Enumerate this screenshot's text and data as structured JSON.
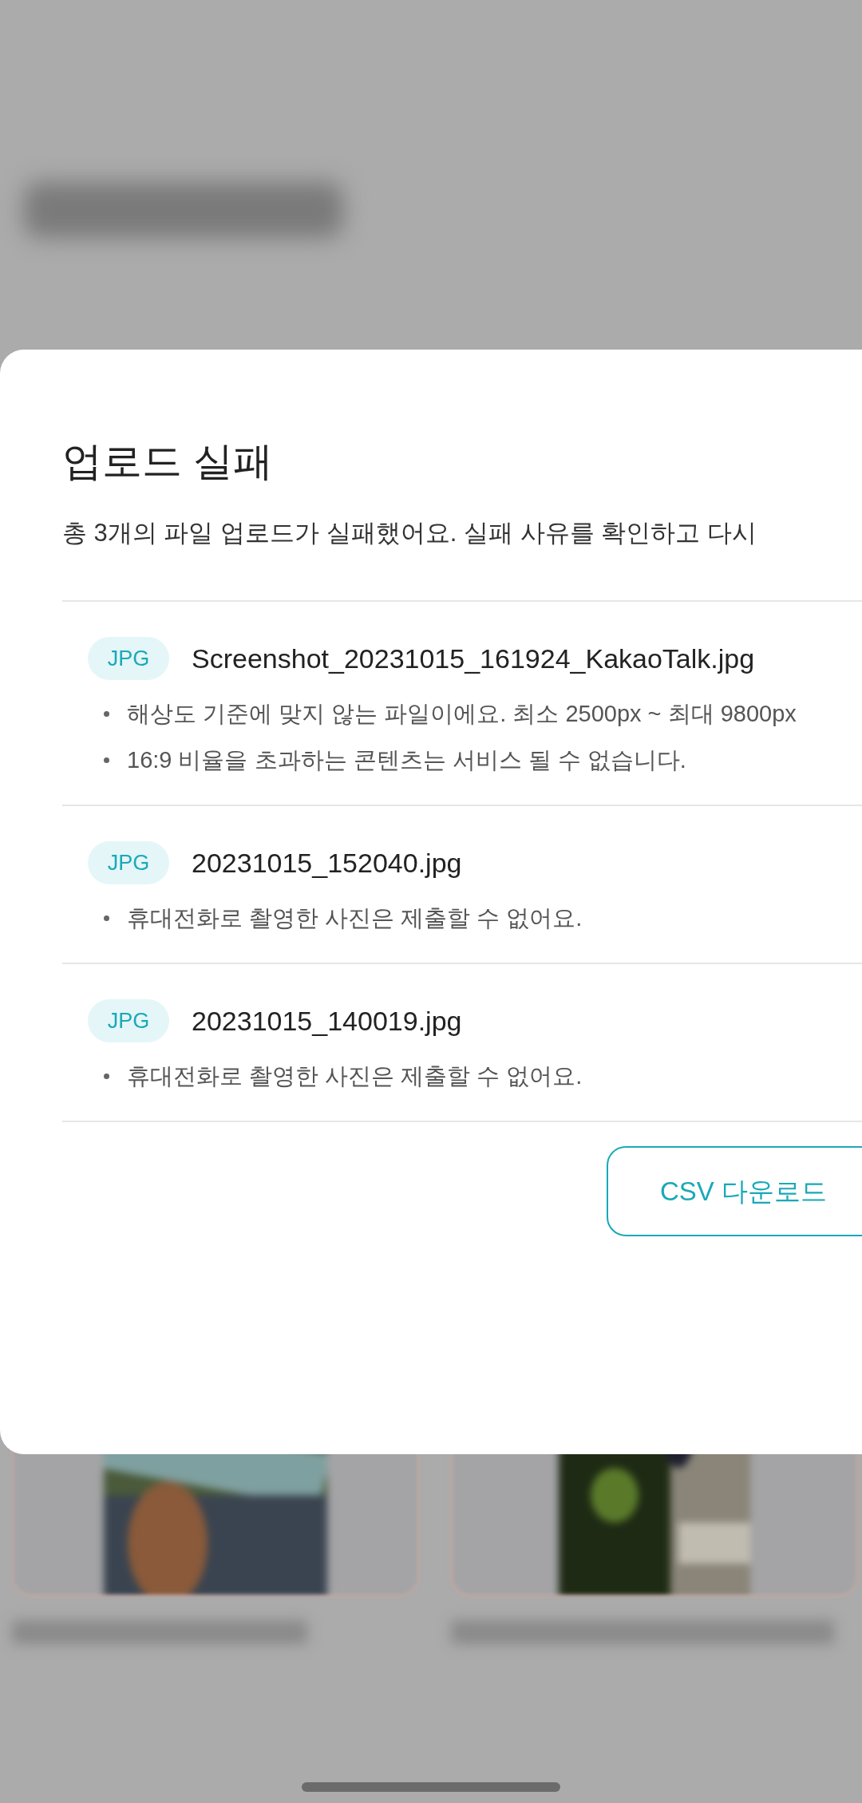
{
  "dialog": {
    "title": "업로드 실패",
    "description": "총 3개의 파일 업로드가 실패했어요. 실패 사유를 확인하고 다시",
    "files": [
      {
        "type": "JPG",
        "name": "Screenshot_20231015_161924_KakaoTalk.jpg",
        "reasons": [
          "해상도 기준에 맞지 않는 파일이에요. 최소 2500px ~ 최대 9800px",
          "16:9 비율을 초과하는 콘텐츠는 서비스 될 수 없습니다."
        ]
      },
      {
        "type": "JPG",
        "name": "20231015_152040.jpg",
        "reasons": [
          "휴대전화로 촬영한 사진은 제출할 수 없어요."
        ]
      },
      {
        "type": "JPG",
        "name": "20231015_140019.jpg",
        "reasons": [
          "휴대전화로 촬영한 사진은 제출할 수 없어요."
        ]
      }
    ],
    "button": "CSV 다운로드"
  }
}
